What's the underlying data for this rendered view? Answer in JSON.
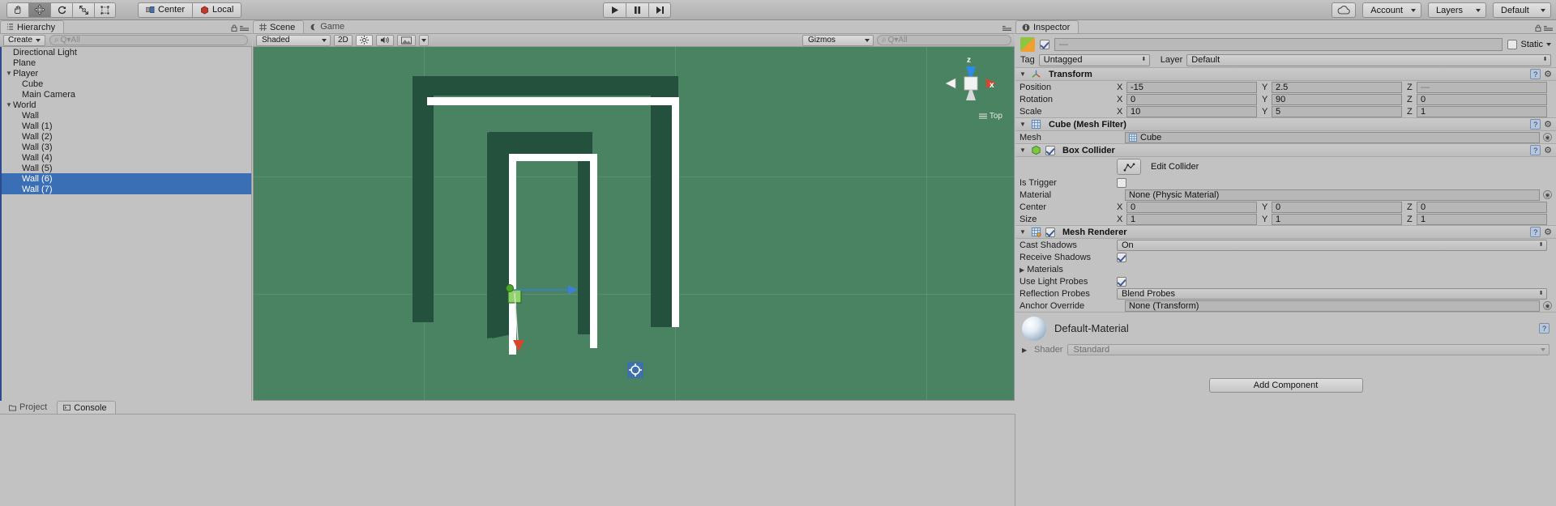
{
  "toolbar": {
    "transform_tools": [
      {
        "name": "hand-tool",
        "icon": "hand",
        "active": false
      },
      {
        "name": "move-tool",
        "icon": "move",
        "active": true
      },
      {
        "name": "rotate-tool",
        "icon": "rotate",
        "active": false
      },
      {
        "name": "scale-tool",
        "icon": "scale",
        "active": false
      },
      {
        "name": "rect-tool",
        "icon": "rect",
        "active": false
      }
    ],
    "pivot_label": "Center",
    "space_label": "Local",
    "play_label": "▶",
    "pause_label": "❚❚",
    "step_label": "▶❙",
    "cloud_label": "cloud",
    "account_label": "Account",
    "layers_label": "Layers",
    "layout_label": "Default"
  },
  "hierarchy": {
    "tab_label": "Hierarchy",
    "create_label": "Create",
    "search_placeholder": "Q▾All",
    "items": [
      {
        "label": "Directional Light",
        "depth": 0,
        "expandable": false,
        "selected": false
      },
      {
        "label": "Plane",
        "depth": 0,
        "expandable": false,
        "selected": false
      },
      {
        "label": "Player",
        "depth": 0,
        "expandable": true,
        "selected": false
      },
      {
        "label": "Cube",
        "depth": 1,
        "expandable": false,
        "selected": false
      },
      {
        "label": "Main Camera",
        "depth": 1,
        "expandable": false,
        "selected": false
      },
      {
        "label": "World",
        "depth": 0,
        "expandable": true,
        "selected": false
      },
      {
        "label": "Wall",
        "depth": 1,
        "expandable": false,
        "selected": false
      },
      {
        "label": "Wall (1)",
        "depth": 1,
        "expandable": false,
        "selected": false
      },
      {
        "label": "Wall (2)",
        "depth": 1,
        "expandable": false,
        "selected": false
      },
      {
        "label": "Wall (3)",
        "depth": 1,
        "expandable": false,
        "selected": false
      },
      {
        "label": "Wall (4)",
        "depth": 1,
        "expandable": false,
        "selected": false
      },
      {
        "label": "Wall (5)",
        "depth": 1,
        "expandable": false,
        "selected": false
      },
      {
        "label": "Wall (6)",
        "depth": 1,
        "expandable": false,
        "selected": true
      },
      {
        "label": "Wall (7)",
        "depth": 1,
        "expandable": false,
        "selected": true
      }
    ]
  },
  "scene": {
    "tab_scene": "Scene",
    "tab_game": "Game",
    "shading_mode": "Shaded",
    "mode_2d": "2D",
    "gizmos_label": "Gizmos",
    "scene_search_placeholder": "Q▾All",
    "axis_labels": {
      "z": "z",
      "x": "x"
    },
    "view_label": "Top",
    "background_color": "#4a8361",
    "wall_color": "#ffffff",
    "shadow_color": "#24503e"
  },
  "inspector": {
    "tab_label": "Inspector",
    "object_name": "—",
    "static_label": "Static",
    "tag_label": "Tag",
    "tag_value": "Untagged",
    "layer_label": "Layer",
    "layer_value": "Default",
    "components": [
      {
        "title": "Transform",
        "rows": [
          {
            "label": "Position",
            "type": "vector3",
            "x": "-15",
            "y": "2.5",
            "z": "—",
            "z_empty": true
          },
          {
            "label": "Rotation",
            "type": "vector3",
            "x": "0",
            "y": "90",
            "z": "0"
          },
          {
            "label": "Scale",
            "type": "vector3",
            "x": "10",
            "y": "5",
            "z": "1"
          }
        ]
      },
      {
        "title": "Cube (Mesh Filter)",
        "rows": [
          {
            "label": "Mesh",
            "type": "object",
            "value": "Cube"
          }
        ]
      },
      {
        "title": "Box Collider",
        "edit_collider_label": "Edit Collider",
        "rows": [
          {
            "label": "Is Trigger",
            "type": "checkbox",
            "checked": false
          },
          {
            "label": "Material",
            "type": "object",
            "value": "None (Physic Material)"
          },
          {
            "label": "Center",
            "type": "vector3",
            "x": "0",
            "y": "0",
            "z": "0"
          },
          {
            "label": "Size",
            "type": "vector3",
            "x": "1",
            "y": "1",
            "z": "1"
          }
        ]
      },
      {
        "title": "Mesh Renderer",
        "rows": [
          {
            "label": "Cast Shadows",
            "type": "popup",
            "value": "On"
          },
          {
            "label": "Receive Shadows",
            "type": "checkbox",
            "checked": true
          },
          {
            "label": "Materials",
            "type": "foldout"
          },
          {
            "label": "Use Light Probes",
            "type": "checkbox",
            "checked": true
          },
          {
            "label": "Reflection Probes",
            "type": "popup",
            "value": "Blend Probes"
          },
          {
            "label": "Anchor Override",
            "type": "object",
            "value": "None (Transform)"
          }
        ]
      }
    ],
    "material": {
      "name": "Default-Material",
      "shader_label": "Shader",
      "shader_value": "Standard"
    },
    "add_component_label": "Add Component"
  },
  "bottom": {
    "project_tab": "Project",
    "console_tab": "Console"
  }
}
